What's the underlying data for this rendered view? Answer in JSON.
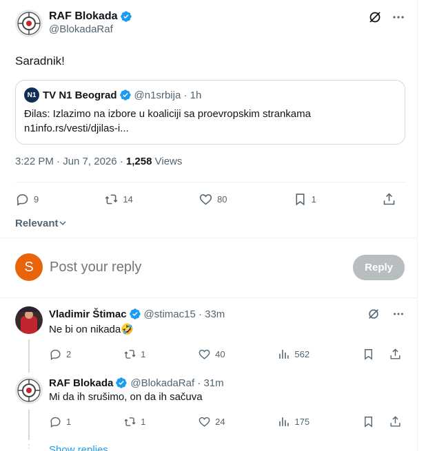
{
  "main_tweet": {
    "author_name": "RAF Blokada",
    "author_handle": "@BlokadaRaf",
    "text": "Saradnik!",
    "quote": {
      "logo_text": "N1",
      "name": "TV N1 Beograd",
      "meta": "@n1srbija · 1h",
      "line1": "Đilas: Izlazimo na izbore u koaliciji sa proevropskim strankama",
      "line2": "n1info.rs/vesti/djilas-i..."
    },
    "timestamp_prefix": "3:22 PM · Jun 7, 2026 · ",
    "views_count": "1,258",
    "views_suffix": " Views",
    "stats": {
      "replies": "9",
      "reposts": "14",
      "likes": "80",
      "bookmarks": "1"
    }
  },
  "sort_label": "Relevant",
  "reply_composer": {
    "avatar_letter": "S",
    "placeholder": "Post your reply",
    "button_label": "Reply"
  },
  "replies": [
    {
      "name": "Vladimir Štimac",
      "meta": "@stimac15 · 33m",
      "text": "Ne bi on nikada🤣",
      "replies": "2",
      "reposts": "1",
      "likes": "40",
      "views": "562"
    },
    {
      "name": "RAF Blokada",
      "meta": "@BlokadaRaf · 31m",
      "text": "Mi da ih srušimo, on da ih sačuva",
      "replies": "1",
      "reposts": "1",
      "likes": "24",
      "views": "175"
    }
  ],
  "show_replies_label": "Show replies",
  "colors": {
    "accent": "#1d9bf0",
    "text_secondary": "#536471",
    "verified": "#1d9bf0",
    "avatar_s": "#e8630a"
  }
}
